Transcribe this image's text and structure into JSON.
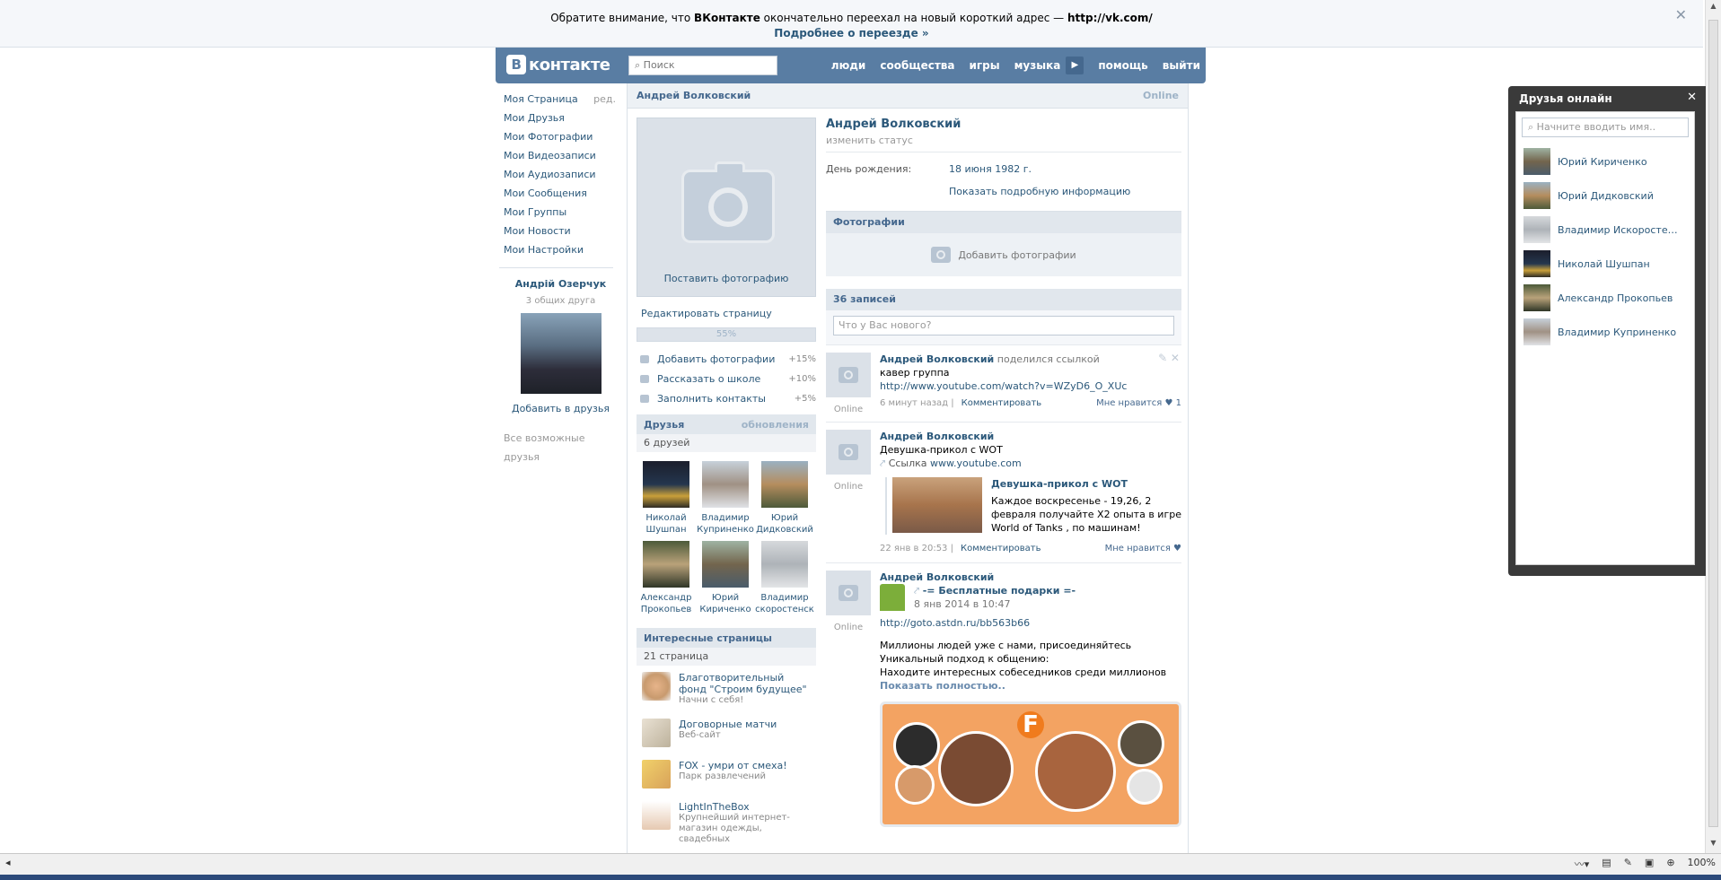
{
  "notice": {
    "text_before": "Обратите внимание, что ",
    "brand": "ВКонтакте",
    "text_middle": " окончательно переехал на новый короткий адрес — ",
    "url": "http://vk.com/",
    "more_link": "Подробнее о переезде »",
    "close_glyph": "✕"
  },
  "header": {
    "logo_letter": "В",
    "logo_text": "контакте",
    "search_placeholder": "Поиск",
    "nav": [
      "люди",
      "сообщества",
      "игры",
      "музыка",
      "помощь",
      "выйти"
    ],
    "play_glyph": "▶",
    "color": "#597da3"
  },
  "sidebar": {
    "items": [
      "Моя Страница",
      "Мои Друзья",
      "Мои Фотографии",
      "Мои Видеозаписи",
      "Мои Аудиозаписи",
      "Мои Сообщения",
      "Мои Группы",
      "Мои Новости",
      "Мои Настройки"
    ],
    "edit_label": "ред.",
    "suggestion": {
      "name": "Андрій Озерчук",
      "common": "3 общих друга",
      "add": "Добавить в друзья"
    },
    "all_possible": "Все возможные друзья"
  },
  "profile": {
    "top_name": "Андрей Волковский",
    "top_status": "Online",
    "put_photo": "Поставить фотографию",
    "edit_page": "Редактировать страницу",
    "progress_label": "55%",
    "progress": 0.55,
    "todo": [
      {
        "label": "Добавить фотографии",
        "pct": "+15%"
      },
      {
        "label": "Рассказать о школе",
        "pct": "+10%"
      },
      {
        "label": "Заполнить контакты",
        "pct": "+5%"
      }
    ],
    "friends_title": "Друзья",
    "friends_updates": "обновления",
    "friends_count": "6 друзей",
    "friends": [
      {
        "first": "Николай",
        "last": "Шушпан"
      },
      {
        "first": "Владимир",
        "last": "Куприненко"
      },
      {
        "first": "Юрий",
        "last": "Дидковский"
      },
      {
        "first": "Александр",
        "last": "Прокопьев"
      },
      {
        "first": "Юрий",
        "last": "Кириченко"
      },
      {
        "first": "Владимир",
        "last": "скоростенск"
      }
    ],
    "pages_title": "Интересные страницы",
    "pages_count": "21 страница",
    "pages": [
      {
        "title": "Благотворительный фонд \"Строим будущее\"",
        "sub": "Начни с себя!"
      },
      {
        "title": "Договорные матчи",
        "sub": "Веб-сайт"
      },
      {
        "title": "FOX - умри от смеха!",
        "sub": "Парк развлечений"
      },
      {
        "title": "LightInTheBox",
        "sub": "Крупнейший интернет-магазин одежды, свадебных"
      }
    ],
    "name": "Андрей Волковский",
    "change_status": "изменить статус",
    "birthday_label": "День рождения:",
    "birthday_value": "18 июня 1982 г.",
    "show_info": "Показать подробную информацию",
    "photos_title": "Фотографии",
    "add_photos": "Добавить фотографии",
    "wall_count": "36 записей",
    "wall_placeholder": "Что у Вас нового?"
  },
  "posts": [
    {
      "author": "Андрей Волковский",
      "action": "поделился ссылкой",
      "text": "кавер группа",
      "link": "http://www.youtube.com/watch?v=WZyD6_O_XUc",
      "time": "6 минут назад",
      "comment": "Комментировать",
      "like": "Мне нравится ♥ 1",
      "online": "Online"
    },
    {
      "author": "Андрей Волковский",
      "text": "Девушка-прикол с WOT",
      "link_prefix": "Ссылка ",
      "link_domain": "www.youtube.com",
      "card_title": "Девушка-прикол с WOT",
      "card_text": "Каждое воскресенье - 19,26, 2 февраля получайте X2 опыта в игре World of Tanks , по машинам!",
      "time": "22 янв в 20:53",
      "comment": "Комментировать",
      "like": "Мне нравится ♥",
      "online": "Online"
    },
    {
      "author": "Андрей Волковский",
      "gift_title": "-= Бесплатные подарки =-",
      "gift_date": "8 янв 2014 в 10:47",
      "link": "http://goto.astdn.ru/bb563b66",
      "line1": "Миллионы людей уже с нами, присоединяйтесь",
      "line2": "Уникальный подход к общению:",
      "line3": "Находите интересных собеседников среди миллионов",
      "show_full": "Показать полностью..",
      "online": "Online"
    }
  ],
  "friends_online": {
    "title": "Друзья онлайн",
    "close_glyph": "✕",
    "search_placeholder": "Начните вводить имя..",
    "list": [
      "Юрий Кириченко",
      "Юрий Дидковский",
      "Владимир Искоростенский",
      "Николай Шушпан",
      "Александр Прокопьев",
      "Владимир Куприненко"
    ]
  },
  "statusbar": {
    "zoom": "100%"
  }
}
